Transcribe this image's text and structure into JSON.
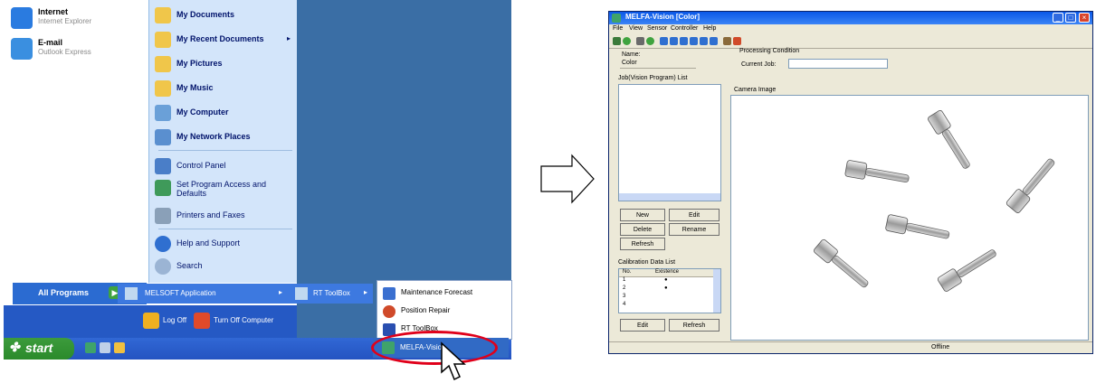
{
  "start_menu": {
    "pinned": [
      {
        "title": "Internet",
        "subtitle": "Internet Explorer",
        "color": "#2a7be0"
      },
      {
        "title": "E-mail",
        "subtitle": "Outlook Express",
        "color": "#3a8fe0"
      }
    ],
    "right_items": [
      {
        "label": "My Documents",
        "bold": true,
        "color": "#f0c64a"
      },
      {
        "label": "My Recent Documents",
        "bold": true,
        "color": "#f0c64a",
        "arrow": "▸"
      },
      {
        "label": "My Pictures",
        "bold": true,
        "color": "#f0c64a"
      },
      {
        "label": "My Music",
        "bold": true,
        "color": "#f0c64a"
      },
      {
        "label": "My Computer",
        "bold": true,
        "color": "#6aa0d8"
      },
      {
        "label": "My Network Places",
        "bold": true,
        "color": "#5a8fcf"
      },
      {
        "label": "Control Panel",
        "bold": false,
        "color": "#4a7ec8"
      },
      {
        "label": "Set Program Access and Defaults",
        "bold": false,
        "color": "#3f9a5a"
      },
      {
        "label": "Printers and Faxes",
        "bold": false,
        "color": "#8aa0b8"
      },
      {
        "label": "Help and Support",
        "bold": false,
        "color": "#2f6fd0"
      },
      {
        "label": "Search",
        "bold": false,
        "color": "#9bb4d4"
      }
    ],
    "all_programs": "All Programs",
    "melsoft": "MELSOFT Application",
    "rt_toolbox": "RT ToolBox",
    "log_off": "Log Off",
    "turn_off": "Turn Off Computer",
    "start": "start",
    "submenu": [
      {
        "label": "Maintenance Forecast",
        "color": "#3a6fd0"
      },
      {
        "label": "Position Repair",
        "color": "#d04a2a"
      },
      {
        "label": "RT ToolBox",
        "color": "#2a4fb0"
      }
    ],
    "melfa_item": "MELFA-Vision"
  },
  "window": {
    "title": "MELFA-Vision [Color]",
    "menu": [
      "File",
      "View",
      "Sensor",
      "Controller",
      "Help"
    ],
    "name_label": "Name:",
    "name_value": "Color",
    "processing_label": "Processing Condition",
    "current_job_label": "Current Job:",
    "job_list_label": "Job(Vision Program) List",
    "camera_label": "Camera Image",
    "buttons": {
      "new": "New",
      "edit": "Edit",
      "delete": "Delete",
      "rename": "Rename",
      "refresh": "Refresh",
      "edit2": "Edit",
      "refresh2": "Refresh"
    },
    "calibration_label": "Calibration Data List",
    "calibration_headers": [
      "No.",
      "Existence"
    ],
    "calibration_rows": [
      [
        "1",
        "●"
      ],
      [
        "2",
        "●"
      ],
      [
        "3",
        ""
      ],
      [
        "4",
        ""
      ]
    ],
    "status": "Offline"
  }
}
